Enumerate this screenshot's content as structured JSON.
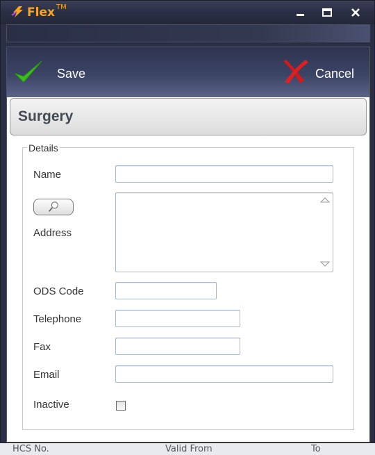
{
  "app": {
    "name": "Flex",
    "trademark": "TM"
  },
  "toolbar": {
    "save_label": "Save",
    "cancel_label": "Cancel"
  },
  "section": {
    "title": "Surgery"
  },
  "details": {
    "legend": "Details",
    "name_label": "Name",
    "address_label": "Address",
    "ods_code_label": "ODS Code",
    "telephone_label": "Telephone",
    "fax_label": "Fax",
    "email_label": "Email",
    "inactive_label": "Inactive",
    "name_value": "",
    "address_value": "",
    "ods_code_value": "",
    "telephone_value": "",
    "fax_value": "",
    "email_value": "",
    "inactive_checked": false
  },
  "background": {
    "col1": "HCS No.",
    "col2": "Valid From",
    "col3": "To"
  },
  "colors": {
    "accent": "#f5a623",
    "save_check": "#3cbf1e",
    "cancel_x": "#d81818",
    "toolbar": "#3c4466"
  }
}
